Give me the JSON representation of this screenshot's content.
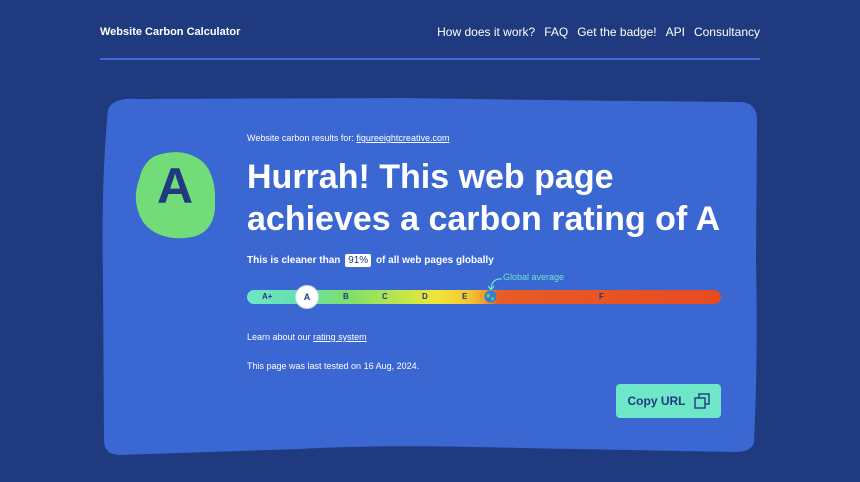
{
  "header": {
    "brand": "Website Carbon Calculator",
    "nav": [
      {
        "label": "How does it work?"
      },
      {
        "label": "FAQ"
      },
      {
        "label": "Get the badge!"
      },
      {
        "label": "API"
      },
      {
        "label": "Consultancy"
      }
    ]
  },
  "result": {
    "results_for_label": "Website carbon results for:",
    "domain": "figureeightcreative.com",
    "rating": "A",
    "headline_line1": "Hurrah! This web page",
    "headline_line2": "achieves a carbon rating of A",
    "cleaner_prefix": "This is cleaner than",
    "cleaner_percent": "91%",
    "cleaner_suffix": "of all web pages globally",
    "global_average_label": "Global average",
    "grades": [
      "A+",
      "A",
      "B",
      "C",
      "D",
      "E",
      "F"
    ],
    "learn_prefix": "Learn about our",
    "learn_link": "rating system",
    "tested_text": "This page was last tested on 16 Aug, 2024.",
    "copy_label": "Copy URL"
  },
  "colors": {
    "background": "#1f3a7e",
    "card": "#3a67d2",
    "accent": "#6ee6c8",
    "blob": "#72dc78"
  },
  "icons": {
    "globe": "globe-icon",
    "copy": "copy-icon",
    "arrow": "curved-arrow-icon"
  }
}
